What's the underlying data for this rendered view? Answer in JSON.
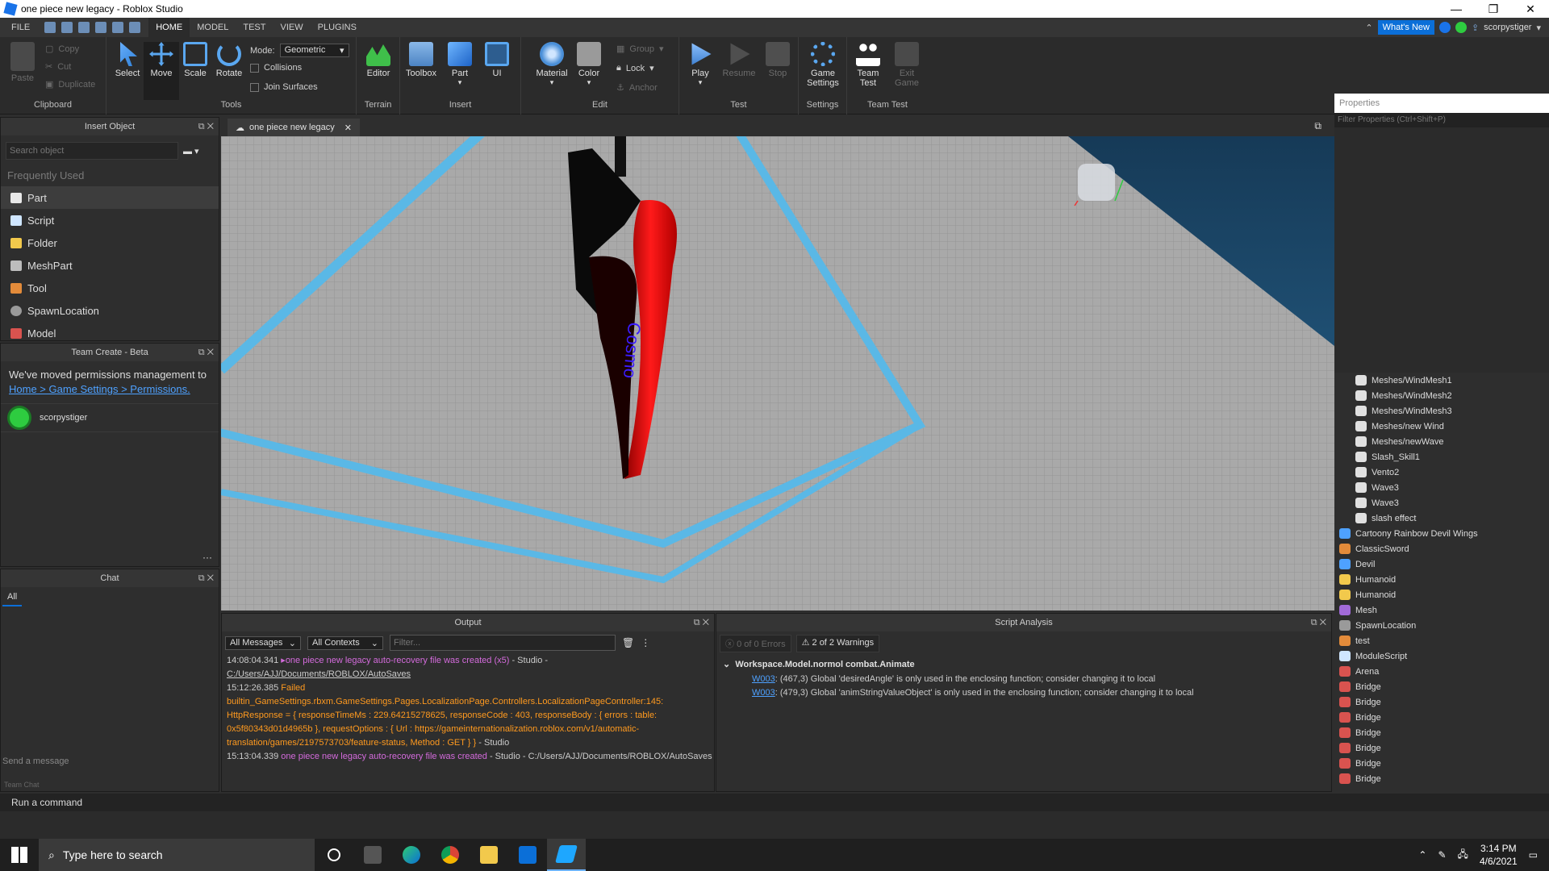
{
  "window": {
    "title": "one piece new legacy - Roblox Studio",
    "controls": [
      "—",
      "❐",
      "✕"
    ]
  },
  "menubar": {
    "file": "FILE",
    "tabs": [
      "HOME",
      "MODEL",
      "TEST",
      "VIEW",
      "PLUGINS"
    ],
    "whats_new": "What's New",
    "username": "scorpystiger"
  },
  "ribbon": {
    "clipboard": {
      "paste": "Paste",
      "copy": "Copy",
      "cut": "Cut",
      "duplicate": "Duplicate",
      "label": "Clipboard"
    },
    "tools": {
      "select": "Select",
      "move": "Move",
      "scale": "Scale",
      "rotate": "Rotate",
      "mode_label": "Mode:",
      "mode_value": "Geometric",
      "collisions": "Collisions",
      "join_surfaces": "Join Surfaces",
      "label": "Tools"
    },
    "terrain": {
      "editor": "Editor",
      "label": "Terrain"
    },
    "insert": {
      "toolbox": "Toolbox",
      "part": "Part",
      "ui": "UI",
      "label": "Insert"
    },
    "edit": {
      "material": "Material",
      "color": "Color",
      "group": "Group",
      "lock": "Lock",
      "anchor": "Anchor",
      "label": "Edit"
    },
    "test": {
      "play": "Play",
      "resume": "Resume",
      "stop": "Stop",
      "label": "Test"
    },
    "settings": {
      "game_settings_1": "Game",
      "game_settings_2": "Settings",
      "label": "Settings"
    },
    "team_test": {
      "team_1": "Team",
      "team_2": "Test",
      "exit_1": "Exit",
      "exit_2": "Game",
      "label": "Team Test"
    }
  },
  "insert_object": {
    "title": "Insert Object",
    "search_placeholder": "Search object",
    "section": "Frequently Used",
    "items": [
      "Part",
      "Script",
      "Folder",
      "MeshPart",
      "Tool",
      "SpawnLocation",
      "Model"
    ]
  },
  "team_create": {
    "title": "Team Create - Beta",
    "message": "We've moved permissions management to",
    "link": "Home > Game Settings > Permissions.",
    "user": "scorpystiger"
  },
  "chat": {
    "title": "Chat",
    "tab": "All",
    "send_placeholder": "Send a message",
    "team_chat": "Team Chat"
  },
  "document_tab": {
    "label": "one piece new legacy"
  },
  "viewport": {
    "sword_text": "Cosmo"
  },
  "output": {
    "title": "Output",
    "filter_messages": "All Messages",
    "filter_contexts": "All Contexts",
    "filter_placeholder": "Filter...",
    "lines": [
      {
        "time": "14:08:04.341",
        "msg": "▸one piece new legacy auto-recovery file was created (x5)",
        "suffix": " - Studio - ",
        "path": "C:/Users/AJJ/Documents/ROBLOX/AutoSaves"
      },
      {
        "time": "15:12:26.385",
        "msg": "Failed"
      },
      {
        "body": "builtin_GameSettings.rbxm.GameSettings.Pages.LocalizationPage.Controllers.LocalizationPageController:145: HttpResponse = { responseTimeMs : 229.64215278625, responseCode : 403, responseBody : { errors : table: 0x5f80343d01d4965b }, requestOptions : { Url : https://gameinternationalization.roblox.com/v1/automatic-translation/games/2197573703/feature-status, Method : GET } }",
        "suffix": " - Studio"
      },
      {
        "time": "15:13:04.339",
        "msg": "one piece new legacy auto-recovery file was created",
        "suffix": " - Studio - C:/Users/AJJ/Documents/ROBLOX/AutoSaves"
      }
    ]
  },
  "script_analysis": {
    "title": "Script Analysis",
    "errors": "0 of 0 Errors",
    "warnings": "2 of 2 Warnings",
    "script": "Workspace.Model.normol combat.Animate",
    "entries": [
      {
        "code": "W003",
        "text": ": (467,3) Global 'desiredAngle' is only used in the enclosing function; consider changing it to local"
      },
      {
        "code": "W003",
        "text": ": (479,3) Global 'animStringValueObject' is only used in the enclosing function; consider changing it to local"
      }
    ]
  },
  "properties": {
    "title": "Properties",
    "filter_placeholder": "Filter Properties (Ctrl+Shift+P)"
  },
  "explorer": {
    "items": [
      {
        "label": "Meshes/WindMesh1",
        "indent": 1,
        "icon": "mesh"
      },
      {
        "label": "Meshes/WindMesh2",
        "indent": 1,
        "icon": "mesh"
      },
      {
        "label": "Meshes/WindMesh3",
        "indent": 1,
        "icon": "mesh"
      },
      {
        "label": "Meshes/new Wind",
        "indent": 1,
        "icon": "mesh"
      },
      {
        "label": "Meshes/newWave",
        "indent": 1,
        "icon": "mesh"
      },
      {
        "label": "Slash_Skill1",
        "indent": 1,
        "icon": "mesh"
      },
      {
        "label": "Vento2",
        "indent": 1,
        "icon": "mesh"
      },
      {
        "label": "Wave3",
        "indent": 1,
        "icon": "mesh"
      },
      {
        "label": "Wave3",
        "indent": 1,
        "icon": "mesh"
      },
      {
        "label": "slash effect",
        "indent": 1,
        "icon": "mesh"
      },
      {
        "label": "Cartoony Rainbow Devil Wings",
        "indent": 0,
        "icon": "accessory"
      },
      {
        "label": "ClassicSword",
        "indent": 0,
        "icon": "tool"
      },
      {
        "label": "Devil",
        "indent": 0,
        "icon": "screen"
      },
      {
        "label": "Humanoid",
        "indent": 0,
        "icon": "humanoid"
      },
      {
        "label": "Humanoid",
        "indent": 0,
        "icon": "humanoid"
      },
      {
        "label": "Mesh",
        "indent": 0,
        "icon": "meshpart"
      },
      {
        "label": "SpawnLocation",
        "indent": 0,
        "icon": "spawn"
      },
      {
        "label": "test",
        "indent": 0,
        "icon": "tool"
      },
      {
        "label": "ModuleScript",
        "indent": 0,
        "icon": "module"
      },
      {
        "label": "Arena",
        "indent": 0,
        "icon": "model"
      },
      {
        "label": "Bridge",
        "indent": 0,
        "icon": "model"
      },
      {
        "label": "Bridge",
        "indent": 0,
        "icon": "model"
      },
      {
        "label": "Bridge",
        "indent": 0,
        "icon": "model"
      },
      {
        "label": "Bridge",
        "indent": 0,
        "icon": "model"
      },
      {
        "label": "Bridge",
        "indent": 0,
        "icon": "model"
      },
      {
        "label": "Bridge",
        "indent": 0,
        "icon": "model"
      },
      {
        "label": "Bridge",
        "indent": 0,
        "icon": "model"
      }
    ]
  },
  "command_bar": {
    "placeholder": "Run a command"
  },
  "taskbar": {
    "search": "Type here to search",
    "time": "3:14 PM",
    "date": "4/6/2021"
  },
  "colors": {
    "accent": "#0b6fd8",
    "magenta_log": "#d46bdc",
    "orange_log": "#ff9a1f"
  }
}
